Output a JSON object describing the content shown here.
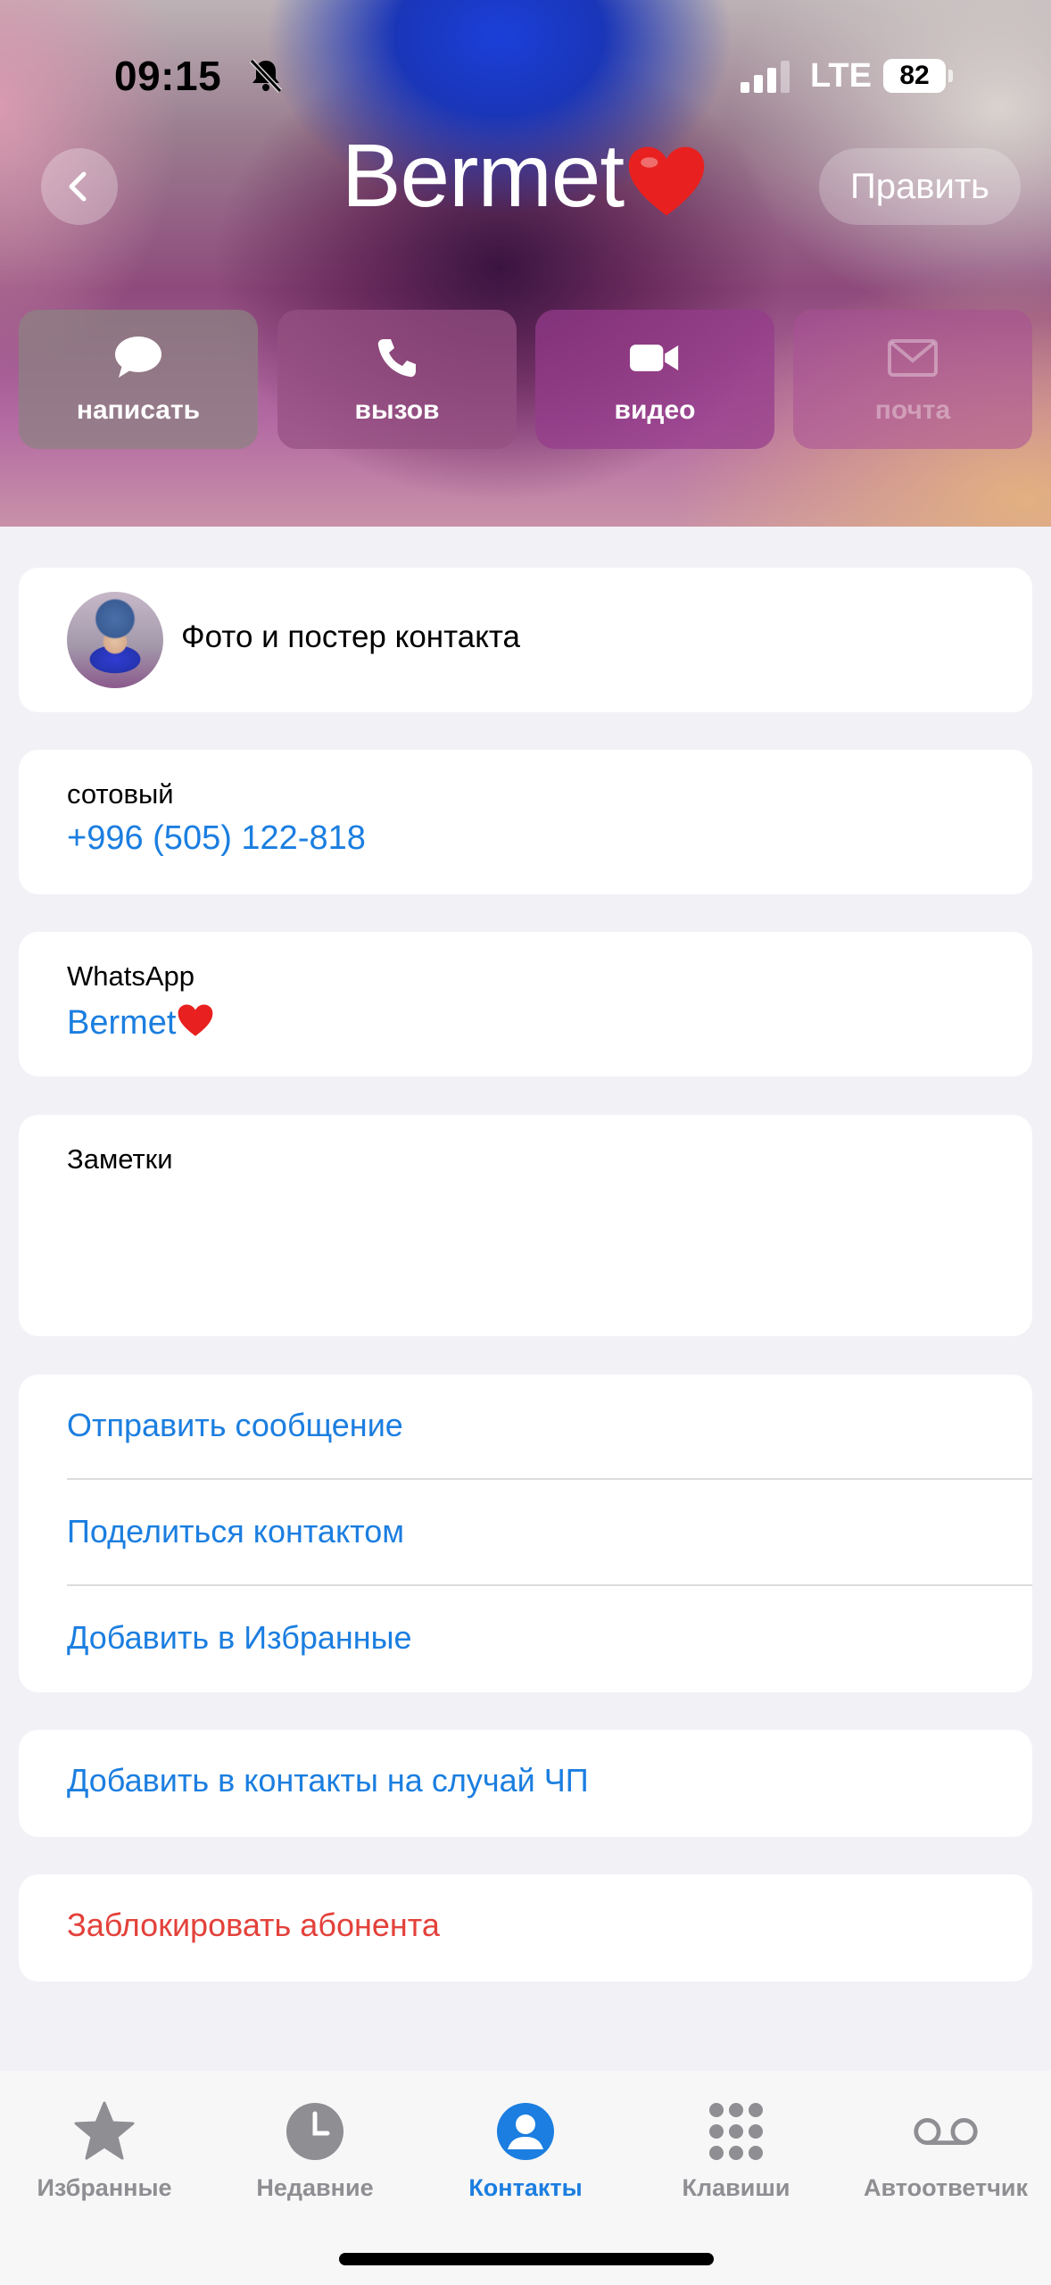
{
  "status": {
    "time": "09:15",
    "network": "LTE",
    "battery": "82"
  },
  "header": {
    "name": "Bermet",
    "edit_label": "Править"
  },
  "actions": [
    {
      "label": "написать",
      "icon": "message-icon"
    },
    {
      "label": "вызов",
      "icon": "phone-icon"
    },
    {
      "label": "видео",
      "icon": "video-icon"
    },
    {
      "label": "почта",
      "icon": "mail-icon",
      "disabled": true
    }
  ],
  "photo_card": {
    "label": "Фото и постер контакта"
  },
  "phone": {
    "label": "сотовый",
    "value": "+996 (505) 122-818"
  },
  "whatsapp": {
    "label": "WhatsApp",
    "value": "Bermet"
  },
  "notes": {
    "label": "Заметки"
  },
  "contact_actions": {
    "send_message": "Отправить сообщение",
    "share_contact": "Поделиться контактом",
    "add_favorites": "Добавить в Избранные"
  },
  "emergency": {
    "label": "Добавить в контакты на случай ЧП"
  },
  "block": {
    "label": "Заблокировать абонента"
  },
  "tabs": [
    {
      "label": "Избранные",
      "icon": "star-icon"
    },
    {
      "label": "Недавние",
      "icon": "clock-icon"
    },
    {
      "label": "Контакты",
      "icon": "person-icon",
      "active": true
    },
    {
      "label": "Клавиши",
      "icon": "keypad-icon"
    },
    {
      "label": "Автоответчик",
      "icon": "voicemail-icon"
    }
  ],
  "colors": {
    "accent": "#1b7ee0",
    "destructive": "#e3413a",
    "background": "#f2f1f6",
    "inactive_tab": "#8e8e93"
  }
}
